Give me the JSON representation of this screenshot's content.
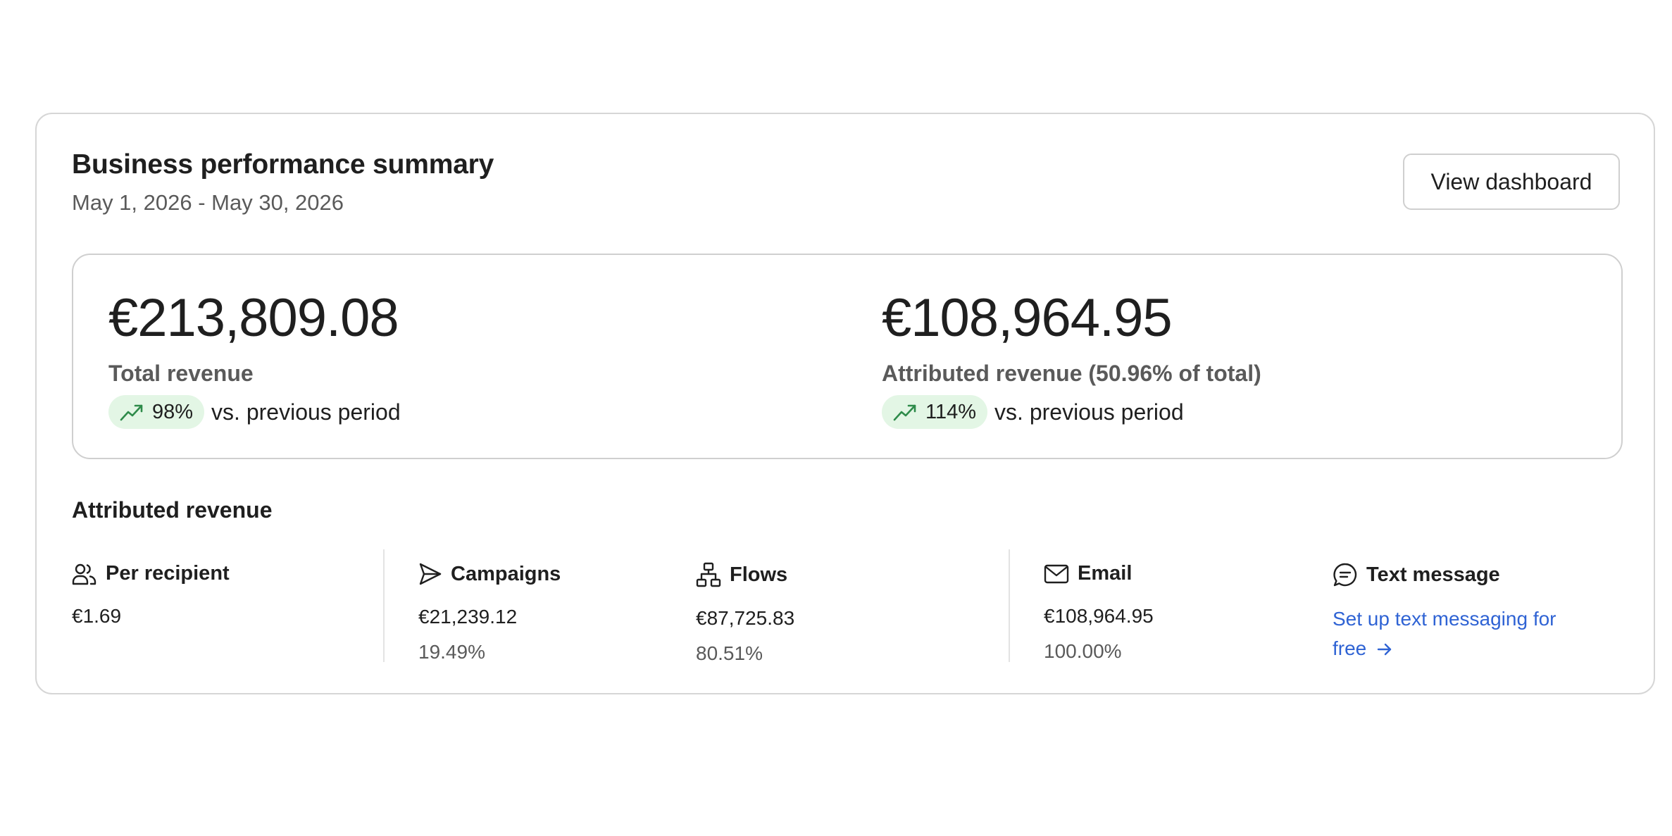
{
  "header": {
    "title": "Business performance summary",
    "date_range": "May 1, 2026 - May 30, 2026",
    "view_button_label": "View dashboard"
  },
  "totals": {
    "total_revenue": {
      "amount": "€213,809.08",
      "label": "Total revenue",
      "trend_pct": "98%",
      "trend_suffix": "vs. previous period",
      "trend_icon": "trending-up-icon"
    },
    "attributed_revenue": {
      "amount": "€108,964.95",
      "label": "Attributed revenue (50.96% of total)",
      "trend_pct": "114%",
      "trend_suffix": "vs. previous period",
      "trend_icon": "trending-up-icon"
    }
  },
  "attributed": {
    "section_title": "Attributed revenue",
    "per_recipient": {
      "label": "Per recipient",
      "icon": "users-icon",
      "value": "€1.69"
    },
    "campaigns": {
      "label": "Campaigns",
      "icon": "send-icon",
      "value": "€21,239.12",
      "pct": "19.49%"
    },
    "flows": {
      "label": "Flows",
      "icon": "flow-icon",
      "value": "€87,725.83",
      "pct": "80.51%"
    },
    "email": {
      "label": "Email",
      "icon": "mail-icon",
      "value": "€108,964.95",
      "pct": "100.00%"
    },
    "text_message": {
      "label": "Text message",
      "icon": "message-icon",
      "link_text": "Set up text messaging for free"
    }
  },
  "colors": {
    "trend_pill_bg": "#e3f6e5",
    "trend_icon": "#2e8b4a",
    "link": "#2f63d4",
    "border": "#d6d6d6"
  }
}
